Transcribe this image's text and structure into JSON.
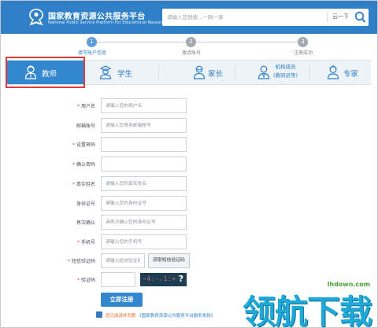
{
  "header": {
    "title_cn": "国家教育资源公共服务平台",
    "title_en": "National Public Service Platform For Educational Resources",
    "search_placeholder": "请输入您想搜...一网一课",
    "search_action": "云一下"
  },
  "steps": [
    {
      "num": "1",
      "label": "填写账户信息",
      "active": true
    },
    {
      "num": "2",
      "label": "激活账号",
      "active": false
    },
    {
      "num": "3",
      "label": "注册成功",
      "active": false
    }
  ],
  "tabs": [
    {
      "label": "教师",
      "icon": "teacher-icon",
      "active": true
    },
    {
      "label": "学生",
      "icon": "student-icon",
      "active": false
    },
    {
      "label": "家长",
      "icon": "parent-icon",
      "active": false
    },
    {
      "label": "机构成员",
      "sublabel": "(教研员等)",
      "icon": "institution-member-icon",
      "active": false
    },
    {
      "label": "专家",
      "icon": "expert-icon",
      "active": false
    }
  ],
  "form": {
    "username": {
      "label": "用户名",
      "required": true,
      "placeholder": "请输入您的用户名"
    },
    "email": {
      "label": "邮箱账号",
      "required": false,
      "placeholder": "请输入您常用邮箱账号"
    },
    "password": {
      "label": "设置密码",
      "required": true,
      "placeholder": ""
    },
    "confirm_password": {
      "label": "确认密码",
      "required": true,
      "placeholder": ""
    },
    "real_name": {
      "label": "真实姓名",
      "required": true,
      "placeholder": "请输入您的真实姓名"
    },
    "id_number": {
      "label": "身份证号",
      "required": false,
      "placeholder": "请输入您的身份证号"
    },
    "confirm_id": {
      "label": "再次确认",
      "required": false,
      "placeholder": "请再次确认您的身份证号"
    },
    "phone": {
      "label": "手机号",
      "required": true,
      "placeholder": "请输入您的手机号"
    },
    "sms_code": {
      "label": "短信验证码",
      "required": true,
      "placeholder": "请输入短信验证码",
      "button": "获取短信验证码"
    },
    "captcha": {
      "label": "验证码",
      "required": true,
      "placeholder": "",
      "image_text": "~4:-.1:>",
      "refresh": "?"
    }
  },
  "register_button": "立即注册",
  "agreement": {
    "prefix": "您已阅读并同意",
    "link": "《国家教育资源公共服务平台服务条款》"
  },
  "watermark": {
    "url": "lhdown.com",
    "text": "领航下载"
  },
  "colors": {
    "primary": "#2f80c8",
    "tab_active": "#3287cf",
    "required": "#e33b3b",
    "highlight_box": "#e03c3c"
  }
}
